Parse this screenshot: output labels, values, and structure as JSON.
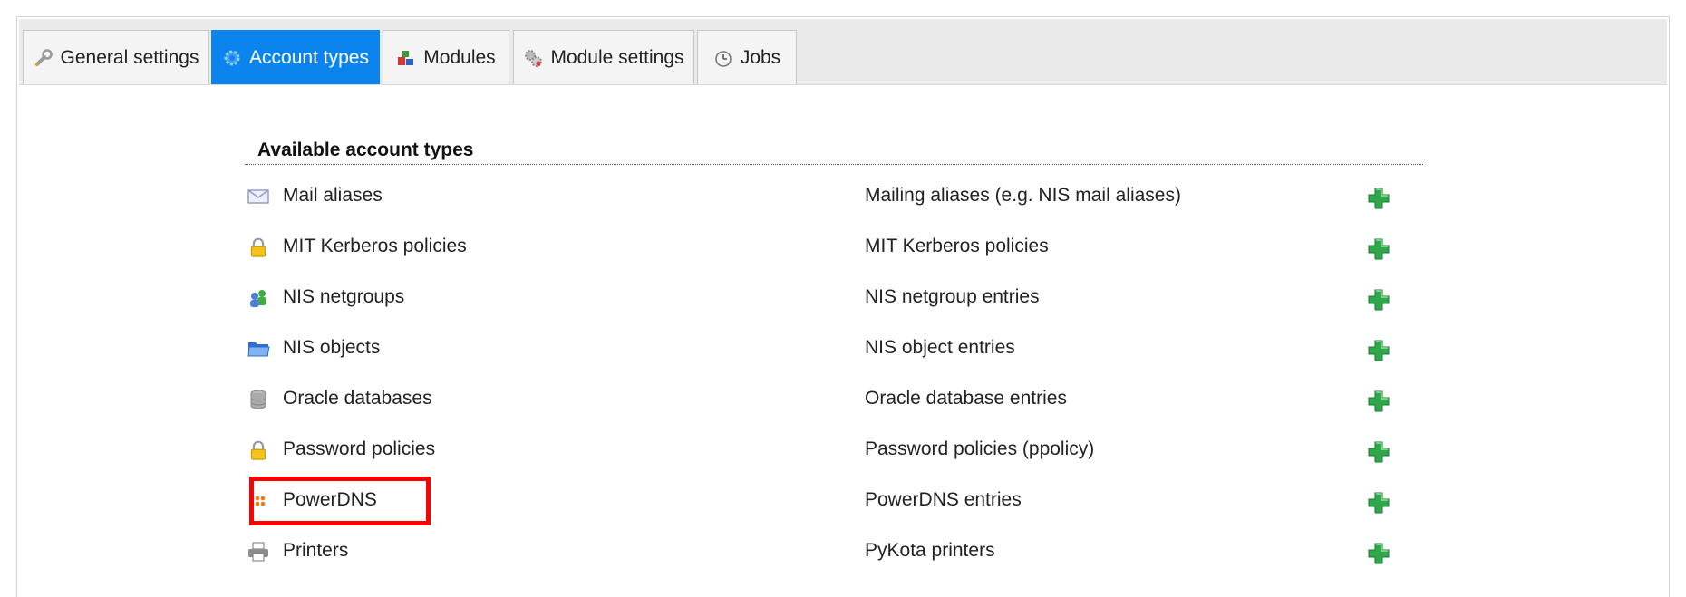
{
  "tabs": [
    {
      "label": "General settings",
      "icon": "wrench-icon",
      "active": false
    },
    {
      "label": "Account types",
      "icon": "gear-icon",
      "active": true
    },
    {
      "label": "Modules",
      "icon": "blocks-icon",
      "active": false
    },
    {
      "label": "Module settings",
      "icon": "gears-icon",
      "active": false
    },
    {
      "label": "Jobs",
      "icon": "clock-icon",
      "active": false
    }
  ],
  "section": {
    "title": "Available account types"
  },
  "account_types": [
    {
      "name": "Mail aliases",
      "description": "Mailing aliases (e.g. NIS mail aliases)",
      "icon": "envelope-icon"
    },
    {
      "name": "MIT Kerberos policies",
      "description": "MIT Kerberos policies",
      "icon": "lock-icon"
    },
    {
      "name": "NIS netgroups",
      "description": "NIS netgroup entries",
      "icon": "users-icon"
    },
    {
      "name": "NIS objects",
      "description": "NIS object entries",
      "icon": "folder-icon"
    },
    {
      "name": "Oracle databases",
      "description": "Oracle database entries",
      "icon": "database-icon"
    },
    {
      "name": "Password policies",
      "description": "Password policies (ppolicy)",
      "icon": "lock-icon"
    },
    {
      "name": "PowerDNS",
      "description": "PowerDNS entries",
      "icon": "dots-icon"
    },
    {
      "name": "Printers",
      "description": "PyKota printers",
      "icon": "printer-icon"
    }
  ],
  "colors": {
    "active_tab": "#0b84ee",
    "add_icon": "#2ea84a",
    "highlight": "#ff0000"
  }
}
